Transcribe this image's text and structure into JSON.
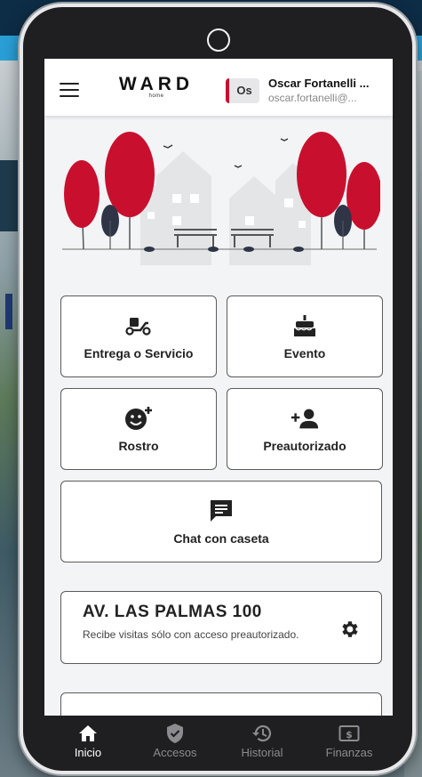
{
  "header": {
    "logo_text": "WARD",
    "logo_sub": "home",
    "avatar_initials": "Os",
    "user_name": "Oscar Fortanelli ...",
    "user_email": "oscar.fortanelli@..."
  },
  "actions": [
    {
      "label": "Entrega o Servicio",
      "icon": "scooter-icon"
    },
    {
      "label": "Evento",
      "icon": "cake-icon"
    },
    {
      "label": "Rostro",
      "icon": "face-add-icon"
    },
    {
      "label": "Preautorizado",
      "icon": "person-add-icon"
    },
    {
      "label": "Chat con caseta",
      "icon": "chat-icon"
    }
  ],
  "property": {
    "title": "AV. LAS PALMAS 100",
    "description": "Recibe visitas sólo con acceso preautorizado."
  },
  "nav": [
    {
      "label": "Inicio",
      "icon": "home-icon",
      "active": true
    },
    {
      "label": "Accesos",
      "icon": "shield-check-icon",
      "active": false
    },
    {
      "label": "Historial",
      "icon": "history-icon",
      "active": false
    },
    {
      "label": "Finanzas",
      "icon": "money-icon",
      "active": false
    }
  ],
  "colors": {
    "brand_red": "#c8102e",
    "nav_bg": "#1f1f22",
    "card_border": "#5b5b5b"
  }
}
